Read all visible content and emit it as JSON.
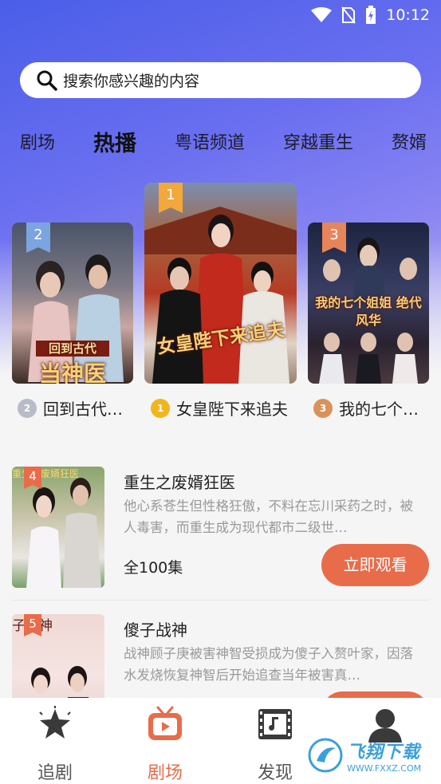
{
  "status_bar": {
    "time": "10:12"
  },
  "search": {
    "placeholder": "搜索你感兴趣的内容"
  },
  "tabs": [
    "剧场",
    "热播",
    "粤语频道",
    "穿越重生",
    "赘婿"
  ],
  "active_tab": "热播",
  "top_three": [
    {
      "rank": "2",
      "title": "回到古代…",
      "art_text": "当神医",
      "art_sub": "回到古代",
      "medal_color": "#b7bcc8"
    },
    {
      "rank": "1",
      "title": "女皇陛下来追夫",
      "art_text": "女皇陛下来追夫",
      "medal_color": "#f2b51c"
    },
    {
      "rank": "3",
      "title": "我的七个…",
      "art_text": "我的七个姐姐 绝代风华",
      "medal_color": "#d9925a"
    }
  ],
  "list": [
    {
      "rank": "4",
      "title": "重生之废婿狂医",
      "desc": "他心系苍生但性格狂傲，不料在忘川采药之时，被人毒害，而重生成为现代都市二级世…",
      "count": "全100集",
      "button": "立即观看",
      "art_text": "重生之废婿狂医"
    },
    {
      "rank": "5",
      "title": "傻子战神",
      "desc": "战神顾子庚被害神智受损成为傻子入赘叶家，因落水发烧恢复神智后开始追查当年被害真…",
      "count": "",
      "button": "",
      "art_text": "子战神"
    }
  ],
  "bottom_nav": [
    {
      "label": "追剧",
      "icon": "star-icon"
    },
    {
      "label": "剧场",
      "icon": "tv-play-icon"
    },
    {
      "label": "发现",
      "icon": "film-music-icon"
    },
    {
      "label": "",
      "icon": "user-icon"
    }
  ],
  "active_nav": "剧场",
  "watermark": {
    "title": "飞翔下载",
    "url": "WWW.FXXZ.COM"
  },
  "colors": {
    "accent": "#e86c4a",
    "rank_badge": "#f2a83a",
    "gradient_start": "#4a5ee8"
  }
}
